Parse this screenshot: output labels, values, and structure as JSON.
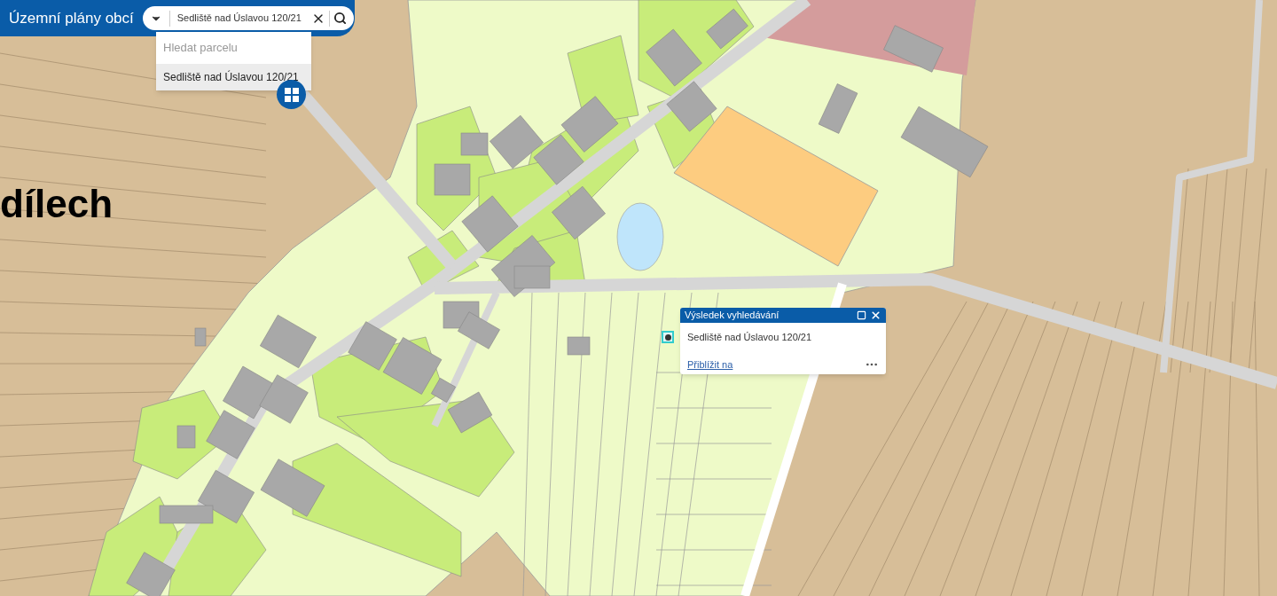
{
  "app_bar": {
    "title": "Územní plány obcí",
    "search": {
      "value": "Sedliště nad Úslavou 120/21"
    }
  },
  "suggestions": {
    "header": "Hledat parcelu",
    "items": [
      {
        "label": "Sedliště nad Úslavou 120/21",
        "selected": true
      }
    ]
  },
  "map": {
    "label": "dílech"
  },
  "popup": {
    "title": "Výsledek vyhledávání",
    "content": "Sedliště nad Úslavou 120/21",
    "link": "Přiblížit na"
  }
}
